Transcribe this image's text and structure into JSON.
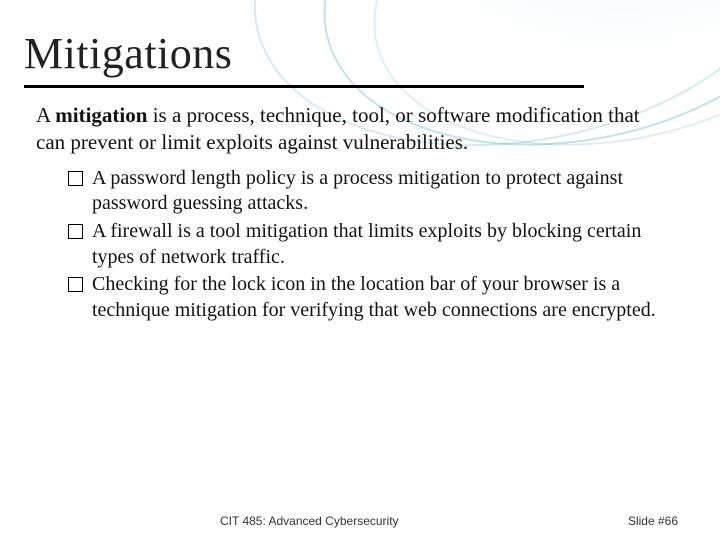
{
  "title": "Mitigations",
  "intro_prefix": "A ",
  "intro_keyword": "mitigation",
  "intro_rest": " is a process, technique, tool, or software modification that can prevent or limit exploits against vulnerabilities.",
  "bullets": [
    "A password length policy is a process mitigation to protect against password guessing attacks.",
    "A firewall is a tool mitigation that limits exploits by blocking certain types of network traffic.",
    "Checking for the lock icon in the location bar of your browser is a technique mitigation for verifying that web connections are encrypted."
  ],
  "footer": {
    "course": "CIT 485: Advanced Cybersecurity",
    "slide": "Slide #66"
  }
}
